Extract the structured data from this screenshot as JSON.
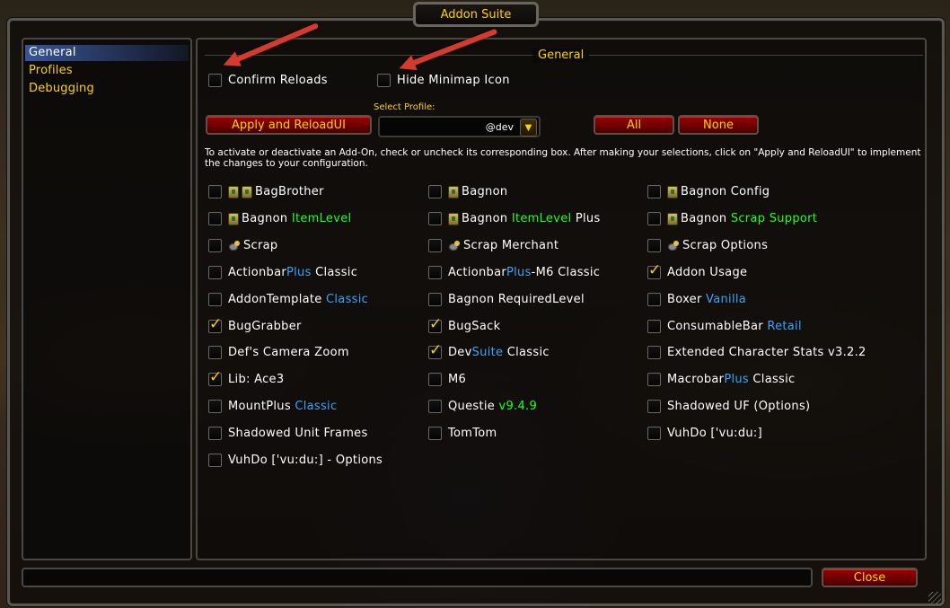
{
  "window": {
    "title": "Addon Suite",
    "close_label": "Close"
  },
  "sidebar": {
    "items": [
      {
        "label": "General",
        "selected": true
      },
      {
        "label": "Profiles",
        "selected": false
      },
      {
        "label": "Debugging",
        "selected": false
      }
    ]
  },
  "general": {
    "section_title": "General",
    "confirm_reloads": {
      "label": "Confirm Reloads",
      "checked": false
    },
    "hide_minimap": {
      "label": "Hide Minimap Icon",
      "checked": false
    },
    "apply_button": "Apply and ReloadUI",
    "select_profile_label": "Select Profile:",
    "profile_value": "@dev",
    "all_button": "All",
    "none_button": "None",
    "description": "To activate or deactivate an Add-On, check or uncheck its corresponding box. After making your selections, click on \"Apply and ReloadUI\" to implement the changes to your configuration."
  },
  "colors": {
    "gold": "#ffd200",
    "blue_highlight": "#3aa3ff",
    "green_highlight": "#20ff20",
    "button_red": "#8a0000"
  },
  "addons": [
    {
      "parts": [
        {
          "t": "BagBrother",
          "c": ""
        }
      ],
      "checked": false,
      "icon": "bag-double-icon"
    },
    {
      "parts": [
        {
          "t": "Bagnon",
          "c": ""
        }
      ],
      "checked": false,
      "icon": "bag-icon"
    },
    {
      "parts": [
        {
          "t": "Bagnon Config",
          "c": ""
        }
      ],
      "checked": false,
      "icon": "bag-icon"
    },
    {
      "parts": [
        {
          "t": "Bagnon ",
          "c": ""
        },
        {
          "t": "ItemLevel",
          "c": "green"
        }
      ],
      "checked": false,
      "icon": "bag-icon"
    },
    {
      "parts": [
        {
          "t": "Bagnon ",
          "c": ""
        },
        {
          "t": "ItemLevel",
          "c": "green"
        },
        {
          "t": " Plus",
          "c": ""
        }
      ],
      "checked": false,
      "icon": "bag-icon"
    },
    {
      "parts": [
        {
          "t": "Bagnon ",
          "c": ""
        },
        {
          "t": "Scrap Support",
          "c": "green"
        }
      ],
      "checked": false,
      "icon": "bag-icon"
    },
    {
      "parts": [
        {
          "t": "Scrap",
          "c": ""
        }
      ],
      "checked": false,
      "icon": "coin-icon"
    },
    {
      "parts": [
        {
          "t": "Scrap Merchant",
          "c": ""
        }
      ],
      "checked": false,
      "icon": "coin-icon"
    },
    {
      "parts": [
        {
          "t": "Scrap Options",
          "c": ""
        }
      ],
      "checked": false,
      "icon": "coin-icon"
    },
    {
      "parts": [
        {
          "t": "Actionbar",
          "c": ""
        },
        {
          "t": "Plus",
          "c": "blue"
        },
        {
          "t": " Classic",
          "c": ""
        }
      ],
      "checked": false,
      "icon": ""
    },
    {
      "parts": [
        {
          "t": "Actionbar",
          "c": ""
        },
        {
          "t": "Plus",
          "c": "blue"
        },
        {
          "t": "-M6 Classic",
          "c": ""
        }
      ],
      "checked": false,
      "icon": ""
    },
    {
      "parts": [
        {
          "t": "Addon Usage",
          "c": ""
        }
      ],
      "checked": true,
      "icon": ""
    },
    {
      "parts": [
        {
          "t": "AddonTemplate ",
          "c": ""
        },
        {
          "t": "Classic",
          "c": "blue"
        }
      ],
      "checked": false,
      "icon": ""
    },
    {
      "parts": [
        {
          "t": "Bagnon RequiredLevel",
          "c": ""
        }
      ],
      "checked": false,
      "icon": ""
    },
    {
      "parts": [
        {
          "t": "Boxer ",
          "c": ""
        },
        {
          "t": "Vanilla",
          "c": "blue"
        }
      ],
      "checked": false,
      "icon": ""
    },
    {
      "parts": [
        {
          "t": "BugGrabber",
          "c": ""
        }
      ],
      "checked": true,
      "icon": ""
    },
    {
      "parts": [
        {
          "t": "BugSack",
          "c": ""
        }
      ],
      "checked": true,
      "icon": ""
    },
    {
      "parts": [
        {
          "t": "ConsumableBar ",
          "c": ""
        },
        {
          "t": "Retail",
          "c": "blue"
        }
      ],
      "checked": false,
      "icon": ""
    },
    {
      "parts": [
        {
          "t": "Def's Camera Zoom",
          "c": ""
        }
      ],
      "checked": false,
      "icon": ""
    },
    {
      "parts": [
        {
          "t": "Dev",
          "c": ""
        },
        {
          "t": "Suite",
          "c": "blue"
        },
        {
          "t": " Classic",
          "c": ""
        }
      ],
      "checked": true,
      "icon": ""
    },
    {
      "parts": [
        {
          "t": "Extended Character Stats v3.2.2",
          "c": ""
        }
      ],
      "checked": false,
      "icon": ""
    },
    {
      "parts": [
        {
          "t": "Lib: Ace3",
          "c": ""
        }
      ],
      "checked": true,
      "icon": ""
    },
    {
      "parts": [
        {
          "t": "M6",
          "c": ""
        }
      ],
      "checked": false,
      "icon": ""
    },
    {
      "parts": [
        {
          "t": "Macrobar",
          "c": ""
        },
        {
          "t": "Plus",
          "c": "blue"
        },
        {
          "t": " Classic",
          "c": ""
        }
      ],
      "checked": false,
      "icon": ""
    },
    {
      "parts": [
        {
          "t": "MountPlus ",
          "c": ""
        },
        {
          "t": "Classic",
          "c": "blue"
        }
      ],
      "checked": false,
      "icon": ""
    },
    {
      "parts": [
        {
          "t": "Questie ",
          "c": ""
        },
        {
          "t": "v9.4.9",
          "c": "green"
        }
      ],
      "checked": false,
      "icon": ""
    },
    {
      "parts": [
        {
          "t": "Shadowed UF (Options)",
          "c": ""
        }
      ],
      "checked": false,
      "icon": ""
    },
    {
      "parts": [
        {
          "t": "Shadowed Unit Frames",
          "c": ""
        }
      ],
      "checked": false,
      "icon": ""
    },
    {
      "parts": [
        {
          "t": "TomTom",
          "c": ""
        }
      ],
      "checked": false,
      "icon": ""
    },
    {
      "parts": [
        {
          "t": "VuhDo ['vu:du:]",
          "c": ""
        }
      ],
      "checked": false,
      "icon": ""
    },
    {
      "parts": [
        {
          "t": "VuhDo ['vu:du:] - Options",
          "c": ""
        }
      ],
      "checked": false,
      "icon": ""
    }
  ]
}
